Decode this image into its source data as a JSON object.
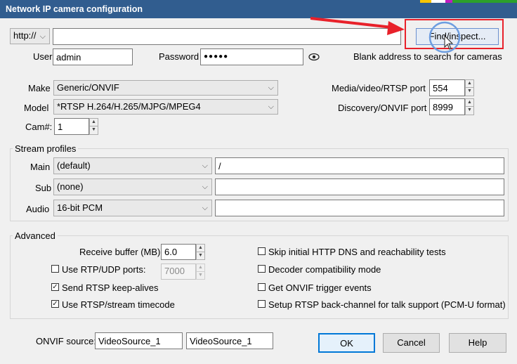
{
  "window": {
    "title": "Network IP camera configuration"
  },
  "address": {
    "scheme": "http://",
    "value": "",
    "find_label": "Find/inspect..."
  },
  "auth": {
    "user_label": "User",
    "user_value": "admin",
    "password_label": "Password",
    "password_value": "●●●●●",
    "hint": "Blank address to search for cameras"
  },
  "camera": {
    "make_label": "Make",
    "make_value": "Generic/ONVIF",
    "model_label": "Model",
    "model_value": "*RTSP H.264/H.265/MJPG/MPEG4",
    "cam_label": "Cam#:",
    "cam_value": "1",
    "media_port_label": "Media/video/RTSP port",
    "media_port_value": "554",
    "discovery_port_label": "Discovery/ONVIF port",
    "discovery_port_value": "8999"
  },
  "streams": {
    "title": "Stream profiles",
    "rows": [
      {
        "label": "Main",
        "profile": "(default)",
        "path": "/"
      },
      {
        "label": "Sub",
        "profile": "(none)",
        "path": ""
      },
      {
        "label": "Audio",
        "profile": "16-bit PCM",
        "path": ""
      }
    ]
  },
  "advanced": {
    "title": "Advanced",
    "buffer_label": "Receive buffer (MB)",
    "buffer_value": "6.0",
    "rtp_label": "Use RTP/UDP ports:",
    "rtp_value": "7000",
    "rtp_checked": false,
    "keepalive_label": "Send RTSP keep-alives",
    "keepalive_checked": true,
    "timecode_label": "Use RTSP/stream timecode",
    "timecode_checked": true,
    "skip_dns_label": "Skip initial HTTP DNS and reachability tests",
    "skip_dns_checked": false,
    "decoder_label": "Decoder compatibility mode",
    "decoder_checked": false,
    "onvif_trigger_label": "Get ONVIF trigger events",
    "onvif_trigger_checked": false,
    "backchannel_label": "Setup RTSP back-channel for talk support (PCM-U format)",
    "backchannel_checked": false
  },
  "footer": {
    "onvif_source_label": "ONVIF source:",
    "source1": "VideoSource_1",
    "source2": "VideoSource_1",
    "ok_label": "OK",
    "cancel_label": "Cancel",
    "help_label": "Help"
  },
  "colors": {
    "titlebar": "#315d8f",
    "annotation_red": "#e8212a",
    "cursor_circle": "#6d9de0"
  },
  "icons": {
    "eye": "eye-icon",
    "cursor": "mouse-cursor-icon"
  }
}
